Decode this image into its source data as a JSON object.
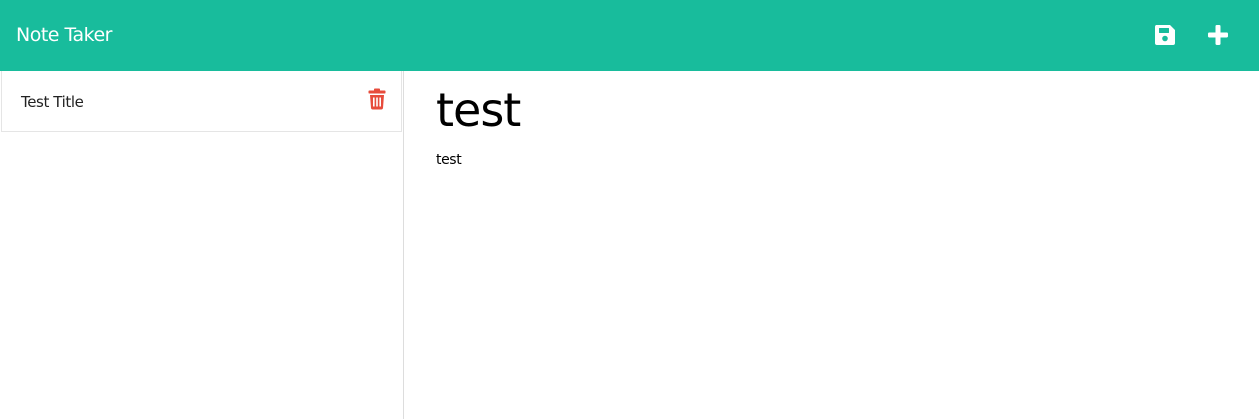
{
  "navbar": {
    "brand": "Note Taker",
    "background_color": "#18bc9c",
    "actions": [
      {
        "icon": "save-icon"
      },
      {
        "icon": "plus-icon"
      }
    ]
  },
  "sidebar": {
    "notes": [
      {
        "title": "Test Title",
        "delete_icon": "trash-icon",
        "delete_icon_color": "#e74c3c"
      }
    ]
  },
  "editor": {
    "title_value": "test",
    "text_value": "test"
  }
}
